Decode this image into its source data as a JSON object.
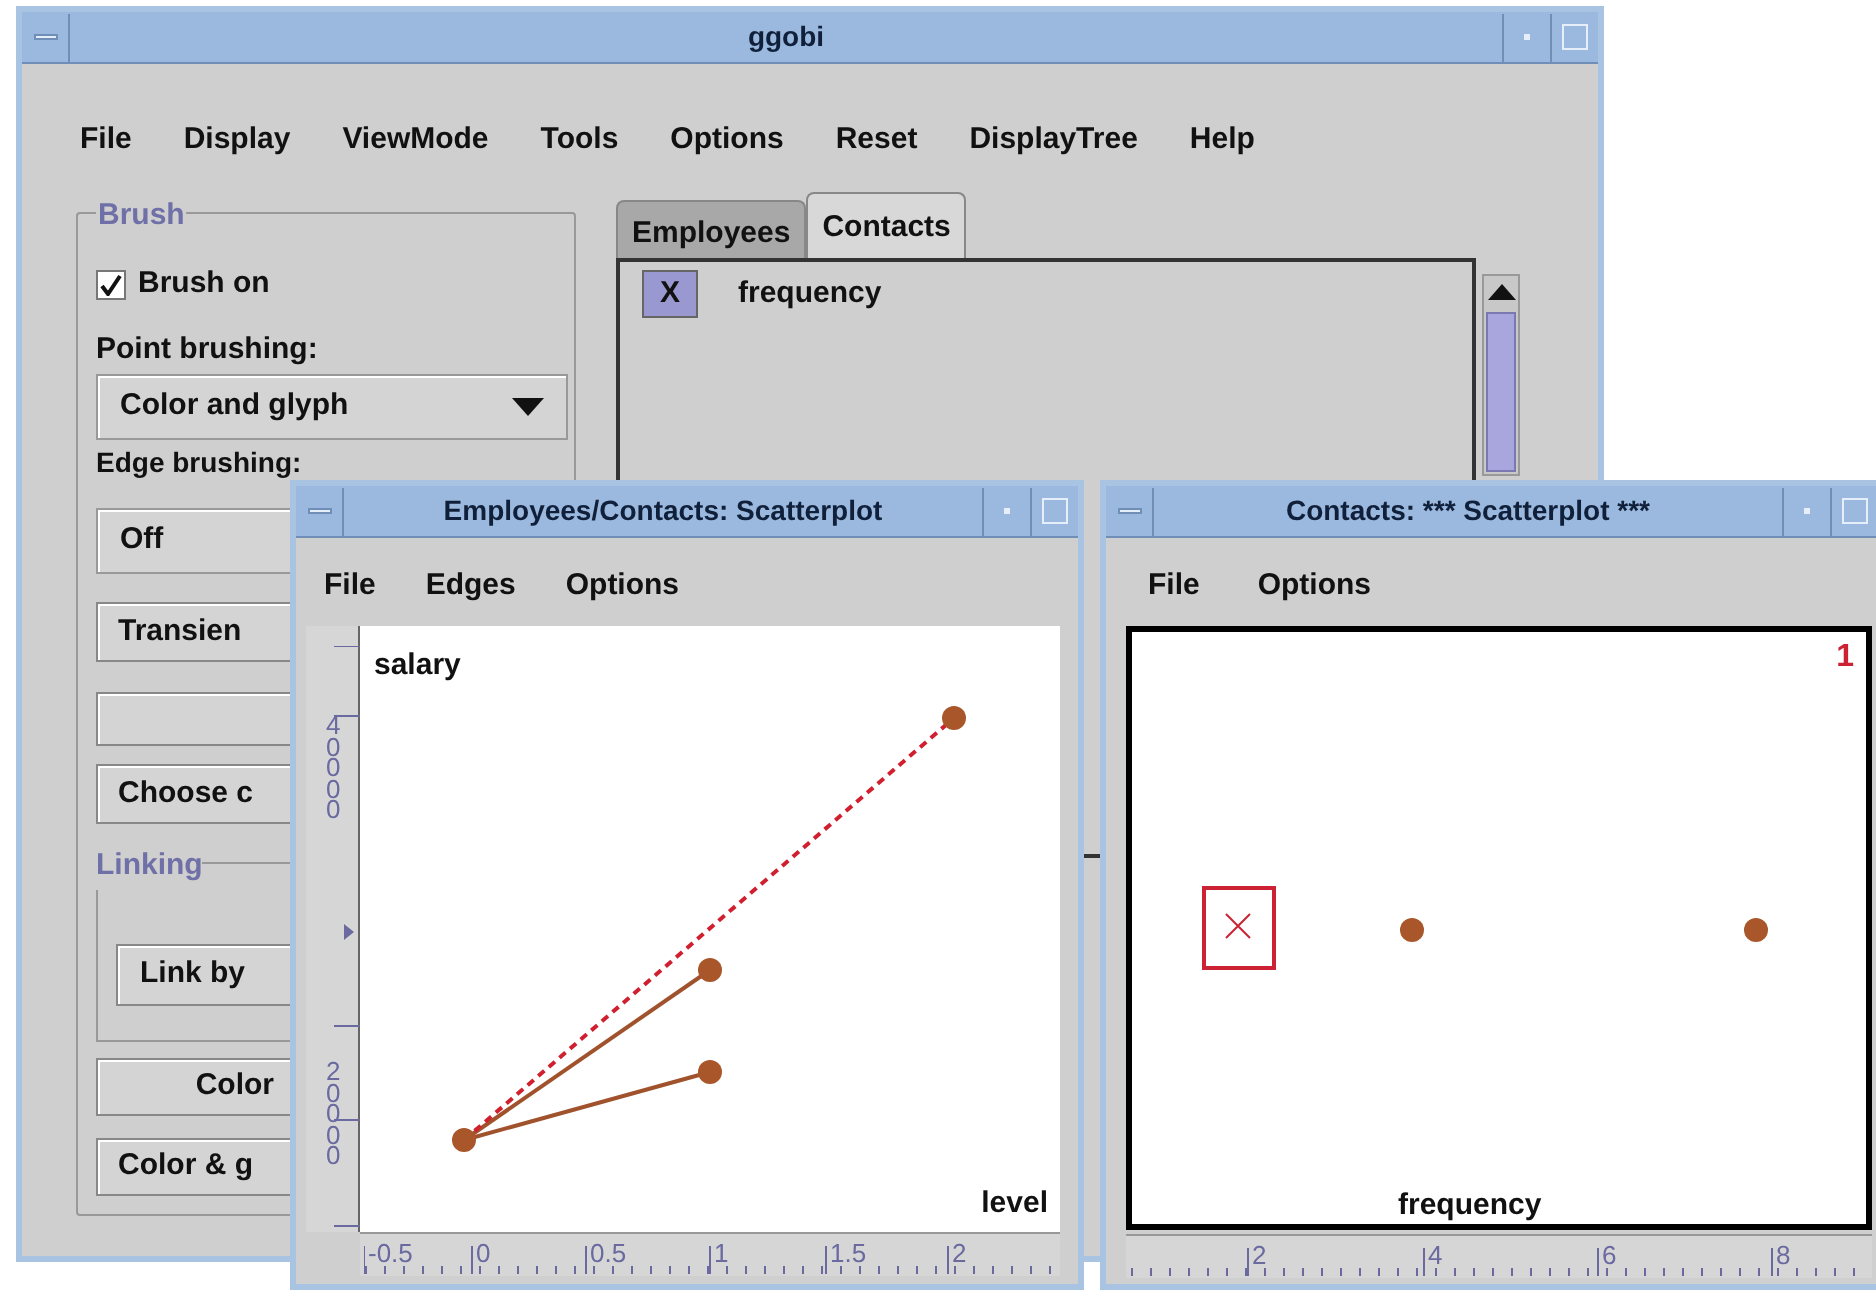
{
  "main_window": {
    "title": "ggobi",
    "menu": [
      "File",
      "Display",
      "ViewMode",
      "Tools",
      "Options",
      "Reset",
      "DisplayTree",
      "Help"
    ],
    "brush_panel": {
      "title": "Brush",
      "brush_on": {
        "label": "Brush on",
        "checked": true
      },
      "point_brushing": {
        "label": "Point brushing:",
        "value": "Color and glyph"
      },
      "edge_brushing": {
        "label": "Edge brushing:",
        "value": "Off"
      },
      "controls": [
        {
          "kind": "button",
          "label": "Transien"
        },
        {
          "kind": "blank"
        },
        {
          "kind": "button",
          "label": "Choose c"
        }
      ],
      "linking": {
        "title": "Linking",
        "button": "Link by"
      },
      "bottom_buttons": [
        "Color",
        "Color & g"
      ]
    },
    "tabs": [
      {
        "label": "Employees",
        "selected": false
      },
      {
        "label": "Contacts",
        "selected": true
      }
    ],
    "variables": [
      {
        "role": "X",
        "name": "frequency"
      }
    ]
  },
  "scatter_window": {
    "title": "Employees/Contacts:  Scatterplot",
    "menu": [
      "File",
      "Edges",
      "Options"
    ],
    "y_label": "salary",
    "x_label": "level",
    "y_ruler": [
      "40000",
      "20000"
    ],
    "x_ruler": [
      "-0.5",
      "0",
      "0.5",
      "1",
      "1.5",
      "2"
    ]
  },
  "contacts_window": {
    "title": "Contacts: *** Scatterplot ***",
    "menu": [
      "File",
      "Options"
    ],
    "plot_number": "1",
    "x_label": "frequency",
    "x_ruler": [
      "2",
      "4",
      "6",
      "8"
    ]
  }
}
